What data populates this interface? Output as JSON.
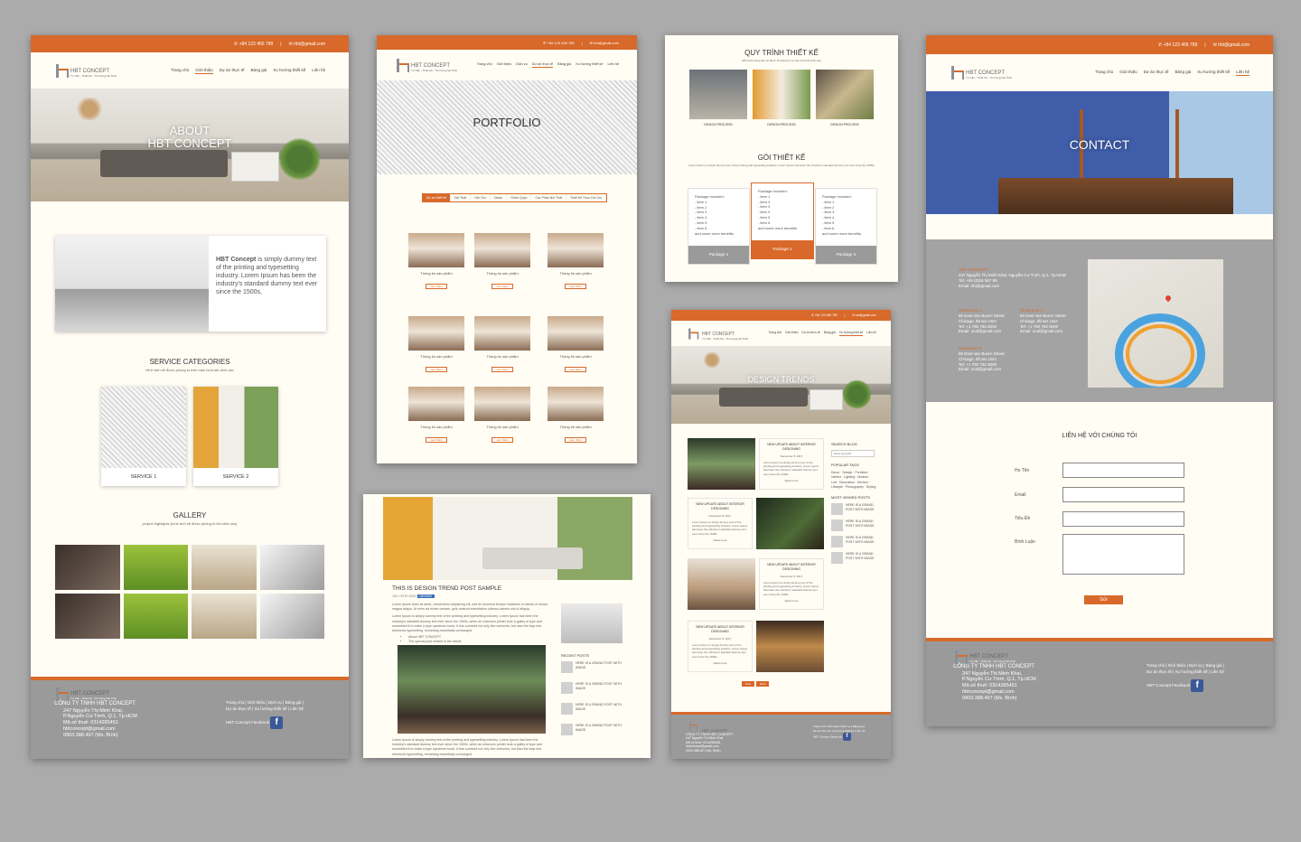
{
  "brand": {
    "name_strong": "HBT",
    "name_light": "CONCEPT",
    "tagline": "Tư Vấn - Thiết Kế - Thi Công Nội Thất",
    "accent": "#d8692a",
    "footer_bg": "#9a9a9a"
  },
  "topbar": {
    "phone": "+84 123 456 789",
    "email": "hbt@gmail.com"
  },
  "nav": [
    "Trang chủ",
    "Giới thiệu",
    "Dự án thực tế",
    "Bảng giá",
    "Xu hướng thiết kế",
    "Liên hệ"
  ],
  "nav_portfolio": [
    "Trang chủ",
    "Giới thiệu",
    "Dịch vụ",
    "Dự án thực tế",
    "Bảng giá",
    "Xu hướng thiết kế",
    "Liên hệ"
  ],
  "about": {
    "hero_title": "ABOUT\nHBT CONCEPT",
    "intro_strong": "HBT Concept",
    "intro_text": " is simply dummy text of the printing and typesetting industry. Lorem Ipsum has been the industry's standard dummy text ever since the 1500s,",
    "services_title": "SERVICE CATEGORIES",
    "services_sub": "Hình ảnh sẽ được phóng to trên màn hình khi click vào",
    "service1": "SERVICE 1",
    "service2": "SERVICE 2",
    "gallery_title": "GALLERY",
    "gallery_sub": "project highlights (hình ảnh sẽ được phóng to khi click vào)"
  },
  "footer": {
    "company": "CÔNG TY TNHH HBT CONCEPT",
    "address1": "247 Nguyễn Thị Minh Khai,",
    "address2": "P.Nguyễn Cư Trinh, Q.1, Tp.HCM",
    "tax": "Mã số thuế: 0314285451",
    "email": "hbtconcept@gmail.com",
    "phone": "0903.388.497 (Ms. Bình)",
    "links1": "Trang chủ | Giới thiệu | Dịch vụ | Bảng giá |",
    "links2": "Dự án thực tế | Xu hướng thiết kế | Liên hệ",
    "facebook": "HBT Concept Facebook",
    "fb_icon": "f"
  },
  "portfolio": {
    "hero_title": "PORTFOLIO",
    "tabs": [
      "Dự án thiết kế",
      "Nội Thất",
      "Văn Tuc",
      "Deaw",
      "Chinh Quyn",
      "Các Phân Nội Thất",
      "Thiết Kế Thực Hà Côn"
    ],
    "product_title": "Thông tin sản phẩm",
    "product_btn": "xem thêm"
  },
  "pricing": {
    "process_title": "QUY TRÌNH THIẾT KẾ",
    "process_sub": "Mỗi bước tổng hợp sẽ được đi phóng to ra màn hình khi click vào",
    "process_steps": [
      "DESIGN PROCESS",
      "DESIGN PROCESS",
      "DESIGN PROCESS"
    ],
    "packages_title": "GÓI THIẾT KẾ",
    "packages_sub": "Lorem Ipsum is simply dummy text of the printing and typesetting industry. Lorem Ipsum has been the industry's standard dummy text ever since the 1500s",
    "packages": [
      {
        "lines": [
          "Package included:",
          "- item 1",
          "- item 2",
          "- item 3",
          "- item 4",
          "- item 5",
          "- item 6",
          "and some more benefits"
        ],
        "name": "Package 1"
      },
      {
        "lines": [
          "Package included:",
          "- item 1",
          "- item 2",
          "- item 3",
          "- item 4",
          "- item 5",
          "- item 6",
          "and some more benefits"
        ],
        "name": "Package 2"
      },
      {
        "lines": [
          "Package included:",
          "- item 1",
          "- item 2",
          "- item 3",
          "- item 4",
          "- item 5",
          "- item 6",
          "and some more benefits"
        ],
        "name": "Package 3"
      }
    ]
  },
  "post": {
    "title": "THIS IS DESIGN TREND POST SAMPLE",
    "date": "JULY 20TH 2020",
    "tag": "DESIGN",
    "p1": "Lorem ipsum dolor sit amet, consectetur adipiscing elit, sed do eiusmod tempor incididunt ut labore et dolore magna aliqua. Ut enim ad minim veniam, quis nostrud exercitation ullamco laboris nisi ut aliquip.",
    "p2": "Lorem Ipsum is simply dummy text of the printing and typesetting industry. Lorem Ipsum has been the industry's standard dummy text ever since the 1500s, when an unknown printer took a galley of type and scrambled it to make a type specimen book. It has survived not only five centuries, but also the leap into electronic typesetting, remaining essentially unchanged.",
    "b1": "About HBT CONCEPT",
    "b2": "The special post related in the article.",
    "p3": "Lorem Ipsum is simply dummy text of the printing and typesetting industry. Lorem Ipsum has been the industry's standard dummy text ever since the 1500s, when an unknown printer took a galley of type and scrambled it to make a type specimen book. It has survived not only five centuries, but also the leap into electronic typesetting, remaining essentially unchanged.",
    "recent_title": "RECENT POSTS",
    "recent": [
      "HERE IS A GRAND POST WITH IMAGE",
      "HERE IS A GRAND POST WITH IMAGE",
      "HERE IS A GRAND POST WITH IMAGE",
      "HERE IS A GRAND POST WITH IMAGE"
    ]
  },
  "trends": {
    "hero_title": "DESIGN TRENDS",
    "post_title": "NEW UPDATE ABOUT INTERIOR DESIGNING",
    "post_date": "December 8, 2017",
    "post_text": "Lorem Ipsum is simply dummy text of the printing and typesetting industry. Lorem Ipsum has been the industry's standard dummy text ever since the 1500s.",
    "read_more": "Read more",
    "search_title": "SEARCH BLOG",
    "search_placeholder": "Enter keyword",
    "tags_title": "POPULAR TAGS",
    "tags": "Decor · Design · Furniture · Interior · Lighting · Modern · Loft · Decoration · Kitchen · Lifestyle · Photography · Styling",
    "most_title": "MOST VIEWED POSTS",
    "most": [
      "HERE IS A GRAND POST WITH IMAGE",
      "HERE IS A GRAND POST WITH IMAGE",
      "HERE IS A GRAND POST WITH IMAGE",
      "HERE IS A GRAND POST WITH IMAGE"
    ],
    "pager": [
      "Prev",
      "Next"
    ]
  },
  "contact": {
    "hero_title": "CONTACT",
    "company": "HBT CONCEPT",
    "address": "247 Nguyễn Thị Minh Khai, Nguyễn Cư Trinh, Q.1, Tp.HCM",
    "tel": "Tel: +84 (0)34 587 89",
    "email": "Email: hbt@gmail.com",
    "showroom1": {
      "name": "Showroom 1",
      "l1": "60 East Van Buren Street",
      "l2": "Chicago, Illinois USA",
      "l3": "Tel: +1 780 782 8000",
      "l4": "Email: ocal@gmail.com"
    },
    "showroom2": {
      "name": "Showroom 2",
      "l1": "60 East Van Buren Street",
      "l2": "Chicago, Illinois USA",
      "l3": "Tel: +1 780 782 8000",
      "l4": "Email: ocal@gmail.com"
    },
    "showroom3": {
      "name": "Showroom 3",
      "l1": "60 East Van Buren Street",
      "l2": "Chicago, Illinois USA",
      "l3": "Tel: +1 780 782 8000",
      "l4": "Email: ocal@gmail.com"
    },
    "form_title": "LIÊN HỆ VỚI CHÚNG TÔI",
    "f_name": "Họ Tên",
    "f_email": "Email",
    "f_subject": "Tiêu Đề",
    "f_comment": "Bình Luận",
    "submit": "Gửi"
  }
}
